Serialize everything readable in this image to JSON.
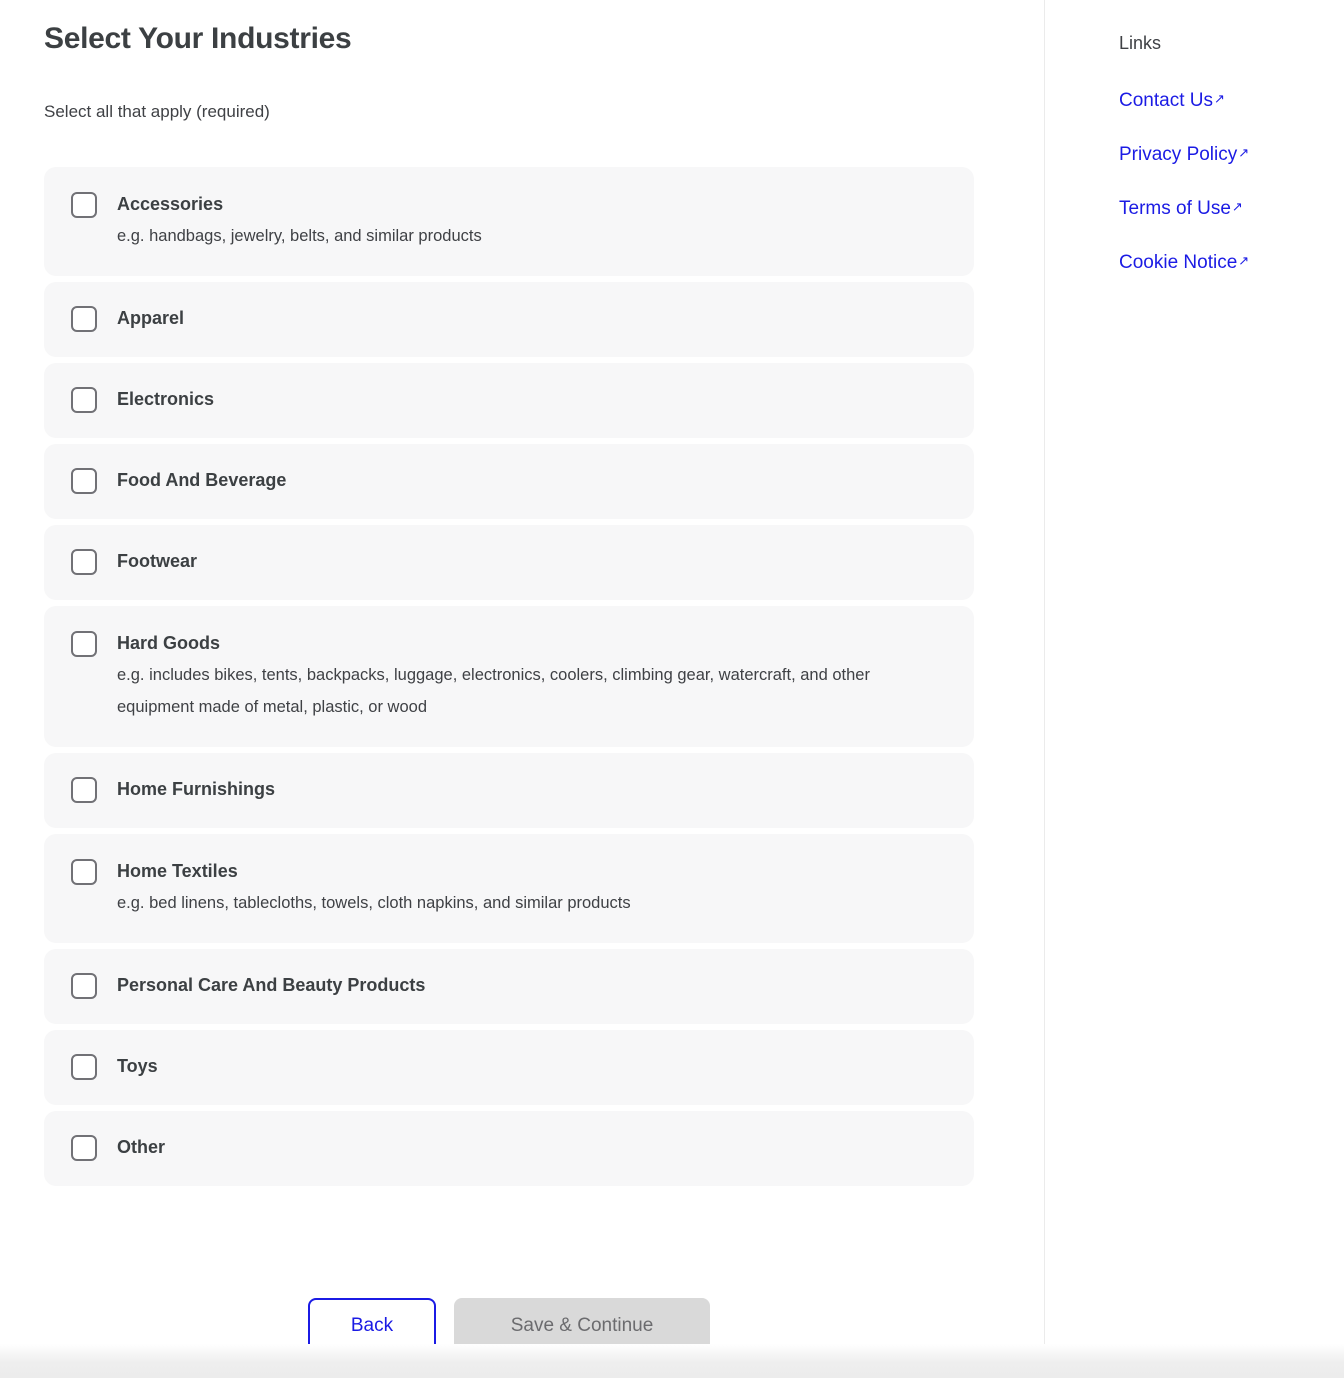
{
  "main": {
    "title": "Select Your Industries",
    "subtitle": "Select all that apply (required)",
    "industries": [
      {
        "label": "Accessories",
        "description": "e.g. handbags, jewelry, belts, and similar products",
        "checked": false
      },
      {
        "label": "Apparel",
        "description": "",
        "checked": false
      },
      {
        "label": "Electronics",
        "description": "",
        "checked": false
      },
      {
        "label": "Food And Beverage",
        "description": "",
        "checked": false
      },
      {
        "label": "Footwear",
        "description": "",
        "checked": false
      },
      {
        "label": "Hard Goods",
        "description": "e.g. includes bikes, tents, backpacks, luggage, electronics, coolers, climbing gear, watercraft, and other equipment made of metal, plastic, or wood",
        "checked": false
      },
      {
        "label": "Home Furnishings",
        "description": "",
        "checked": false
      },
      {
        "label": "Home Textiles",
        "description": "e.g. bed linens, tablecloths, towels, cloth napkins, and similar products",
        "checked": false
      },
      {
        "label": "Personal Care And Beauty Products",
        "description": "",
        "checked": false
      },
      {
        "label": "Toys",
        "description": "",
        "checked": false
      },
      {
        "label": "Other",
        "description": "",
        "checked": false
      }
    ]
  },
  "actions": {
    "back_label": "Back",
    "save_label": "Save & Continue",
    "save_disabled": true
  },
  "aside": {
    "title": "Links",
    "links": [
      {
        "label": "Contact Us",
        "icon": "external-link-icon"
      },
      {
        "label": "Privacy Policy",
        "icon": "external-link-icon"
      },
      {
        "label": "Terms of Use",
        "icon": "external-link-icon"
      },
      {
        "label": "Cookie Notice",
        "icon": "external-link-icon"
      }
    ],
    "external_glyph": "↗"
  },
  "colors": {
    "link_blue": "#1b1be4",
    "row_background": "#f7f7f8",
    "page_background": "#ffffff",
    "text_primary": "#3c4043",
    "checkbox_border": "#717176",
    "disabled_button_background": "#d9d9d9",
    "disabled_button_text": "#6b6b6e"
  }
}
